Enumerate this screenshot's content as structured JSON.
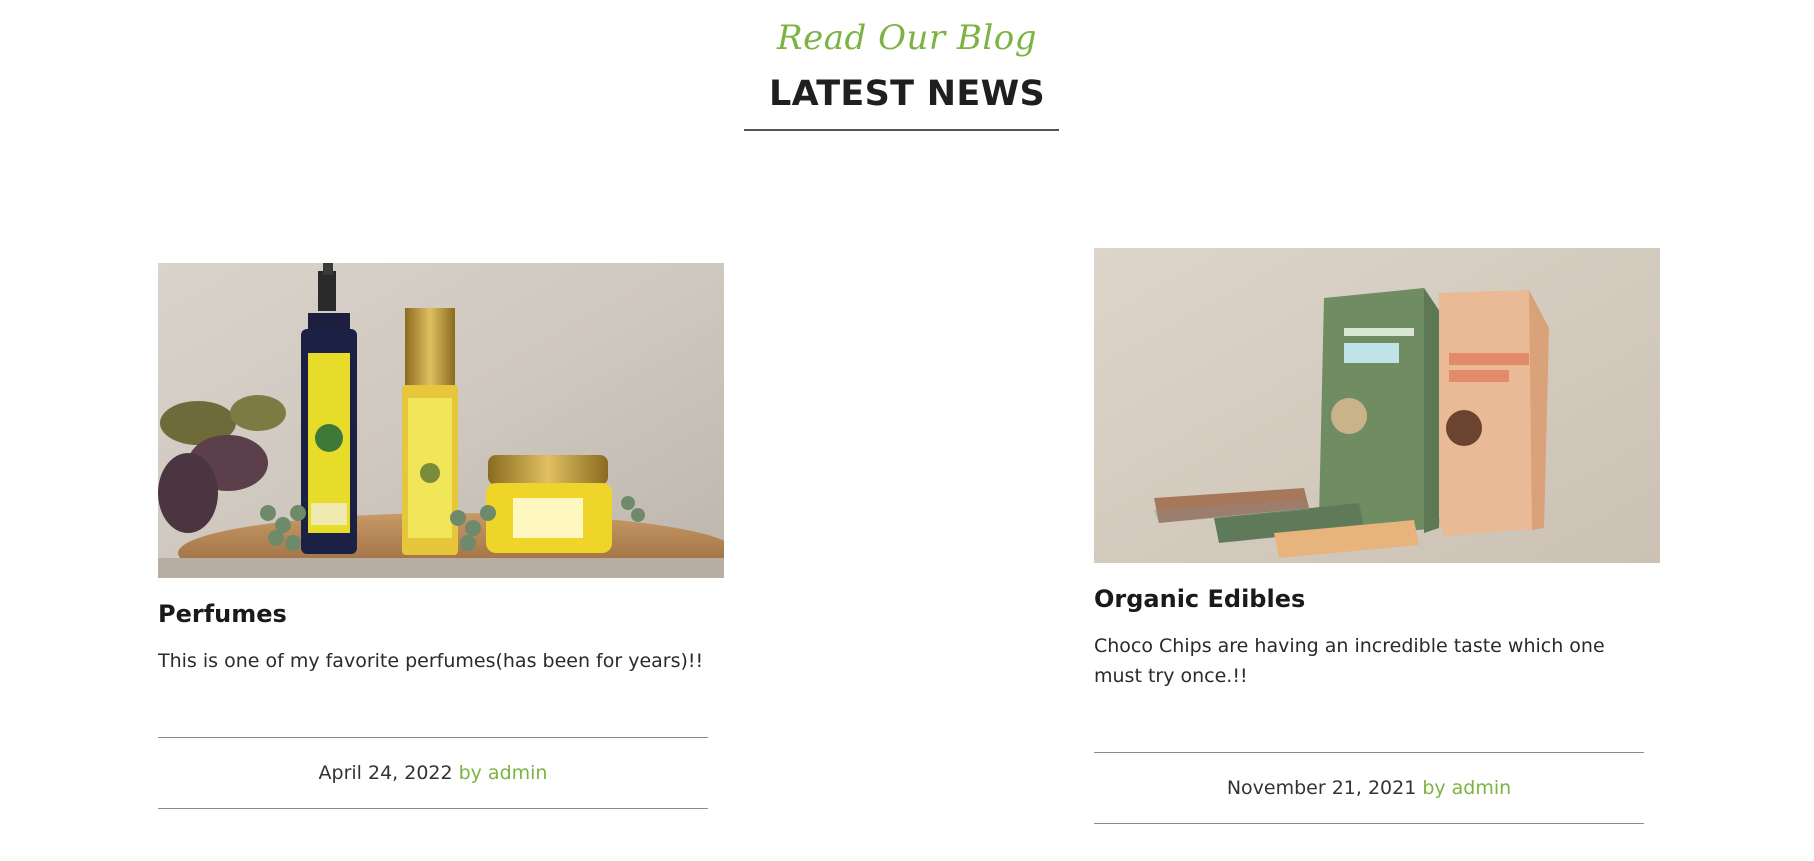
{
  "section": {
    "kicker": "Read Our Blog",
    "title": "LATEST NEWS"
  },
  "posts": [
    {
      "image_alt": "Perfume bottles and cream jar on a wooden slab with flowers",
      "title": "Perfumes",
      "excerpt": "This is one of my favorite perfumes(has been for years)!!",
      "date": "April 24, 2022",
      "by": "by",
      "author": "admin"
    },
    {
      "image_alt": "Genesis Berry Oats and Chocolate Chips packages with chocolate bars",
      "title": "Organic Edibles",
      "excerpt": "Choco Chips are having an incredible taste which one must try once.!!",
      "date": "November 21, 2021",
      "by": "by",
      "author": "admin"
    }
  ],
  "colors": {
    "accent": "#7cb342",
    "heading": "#1f1f1f",
    "rule": "#8a8a8a"
  }
}
